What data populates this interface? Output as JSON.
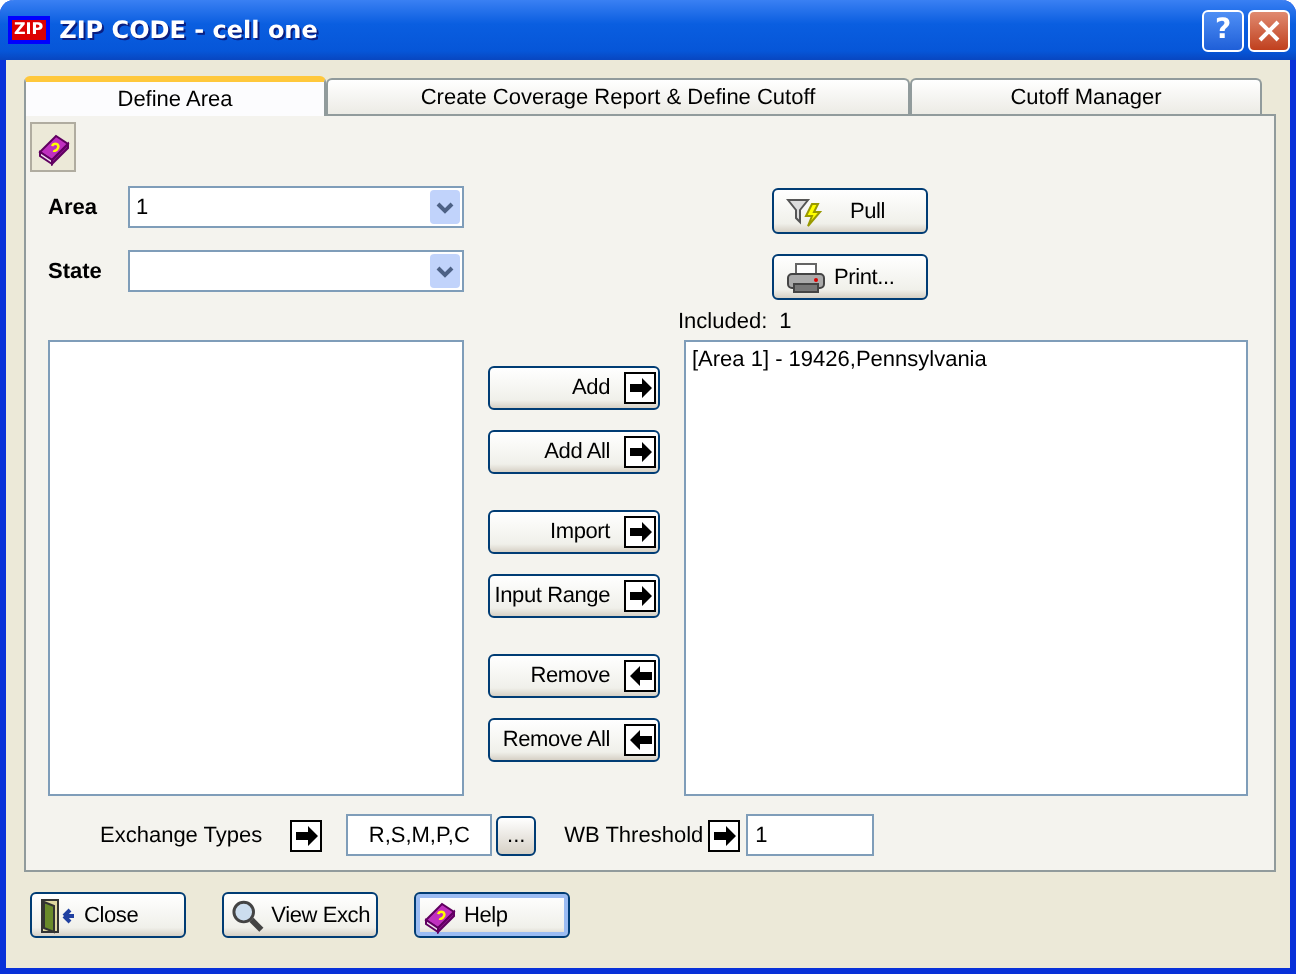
{
  "window": {
    "title": "ZIP CODE - cell one",
    "app_icon_text": "ZIP",
    "help_button": "?"
  },
  "tabs": [
    {
      "label": "Define Area",
      "selected": true
    },
    {
      "label": "Create Coverage Report & Define Cutoff",
      "selected": false
    },
    {
      "label": "Cutoff Manager",
      "selected": false
    }
  ],
  "area": {
    "label": "Area",
    "value": "1"
  },
  "state": {
    "label": "State"
  },
  "action_buttons": [
    {
      "label": "Pull"
    },
    {
      "label": "Print..."
    }
  ],
  "included": {
    "label": "Included:",
    "count": "1"
  },
  "included_list": {
    "items": [
      "[Area 1] - 19426,Pennsylvania"
    ]
  },
  "transfer_buttons": [
    {
      "label": "Add",
      "kind": "add"
    },
    {
      "label": "Add All",
      "kind": "add"
    },
    {
      "label": "Import",
      "kind": "add"
    },
    {
      "label": "Input Range",
      "kind": "add"
    },
    {
      "label": "Remove",
      "kind": "remove"
    },
    {
      "label": "Remove All",
      "kind": "remove"
    }
  ],
  "exchange_types": {
    "label": "Exchange Types",
    "value": "R,S,M,P,C",
    "browse": "..."
  },
  "wb_threshold": {
    "label": "WB Threshold",
    "value": "1"
  },
  "footer_buttons": [
    {
      "label": "Close",
      "focused": false
    },
    {
      "label": "View Exch",
      "focused": false
    },
    {
      "label": "Help",
      "focused": true
    }
  ]
}
